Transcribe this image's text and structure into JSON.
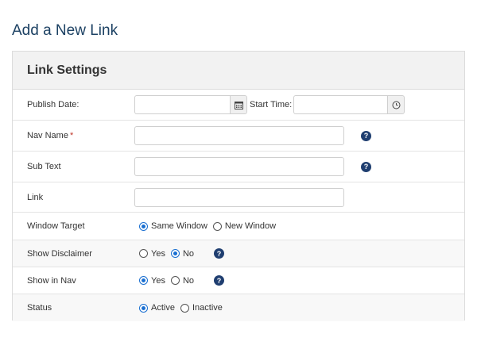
{
  "page": {
    "title": "Add a New Link"
  },
  "panel": {
    "title": "Link Settings",
    "publish_date": {
      "label": "Publish Date:",
      "value": "",
      "calendar_icon": "calendar-icon"
    },
    "start_time": {
      "label": "Start Time:",
      "value": "",
      "clock_icon": "clock-icon"
    },
    "nav_name": {
      "label": "Nav Name",
      "required_mark": "*",
      "value": "",
      "help_icon": "question-icon"
    },
    "sub_text": {
      "label": "Sub Text",
      "value": "",
      "help_icon": "question-icon"
    },
    "link": {
      "label": "Link",
      "value": ""
    },
    "window_target": {
      "label": "Window Target",
      "options": [
        "Same Window",
        "New Window"
      ],
      "selected": "Same Window"
    },
    "show_disclaimer": {
      "label": "Show Disclaimer",
      "options": [
        "Yes",
        "No"
      ],
      "selected": "No",
      "help_icon": "question-icon"
    },
    "show_in_nav": {
      "label": "Show in Nav",
      "options": [
        "Yes",
        "No"
      ],
      "selected": "Yes",
      "help_icon": "question-icon"
    },
    "status": {
      "label": "Status",
      "options": [
        "Active",
        "Inactive"
      ],
      "selected": "Active"
    }
  },
  "colors": {
    "title": "#1c4163",
    "help_icon": "#1f3e70",
    "radio_checked": "#1a6fd1",
    "required": "#c0392b"
  }
}
